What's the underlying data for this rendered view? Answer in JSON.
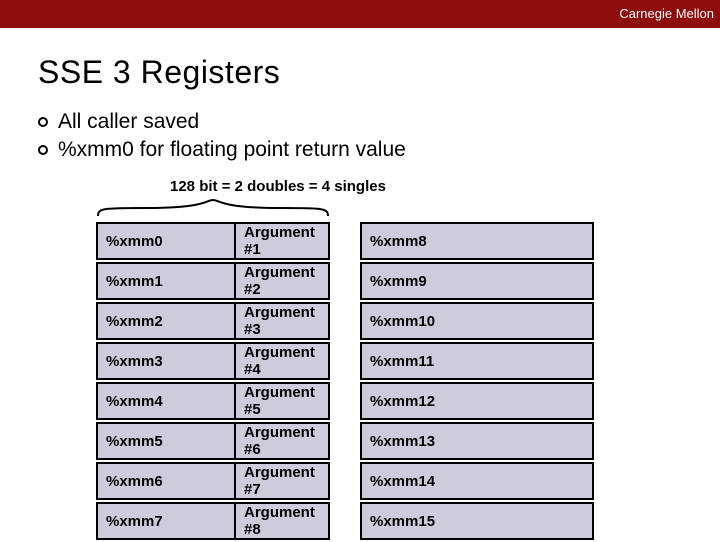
{
  "header": {
    "brand": "Carnegie Mellon"
  },
  "title": "SSE 3 Registers",
  "bullets": [
    "All caller saved",
    "%xmm0 for floating point return value"
  ],
  "brace_label": "128 bit = 2 doubles = 4 singles",
  "rows": [
    {
      "left": "%xmm0",
      "mid": "Argument #1",
      "right": "%xmm8"
    },
    {
      "left": "%xmm1",
      "mid": "Argument #2",
      "right": "%xmm9"
    },
    {
      "left": "%xmm2",
      "mid": "Argument #3",
      "right": "%xmm10"
    },
    {
      "left": "%xmm3",
      "mid": "Argument #4",
      "right": "%xmm11"
    },
    {
      "left": "%xmm4",
      "mid": "Argument #5",
      "right": "%xmm12"
    },
    {
      "left": "%xmm5",
      "mid": "Argument #6",
      "right": "%xmm13"
    },
    {
      "left": "%xmm6",
      "mid": "Argument #7",
      "right": "%xmm14"
    },
    {
      "left": "%xmm7",
      "mid": "Argument #8",
      "right": "%xmm15"
    }
  ]
}
